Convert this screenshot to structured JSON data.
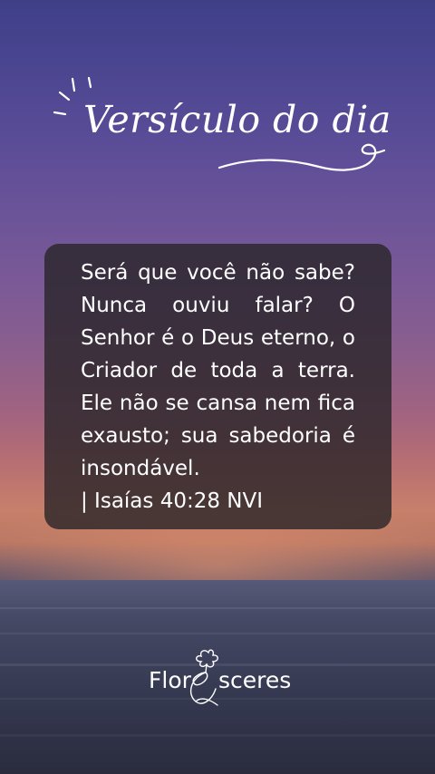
{
  "header": {
    "title": "Versículo do dia"
  },
  "verse": {
    "text": "Será que você não sabe? Nunca ouviu falar? O Senhor é o Deus eterno, o Criador de toda a terra. Ele não se cansa nem fica exausto; sua sabedoria é insondável.",
    "reference": "| Isaías 40:28 NVI"
  },
  "brand": {
    "logo_text": "Flor&sceres",
    "logo_left": "Flor",
    "logo_right": "sceres"
  },
  "colors": {
    "text": "#ffffff",
    "card": "#282428"
  }
}
